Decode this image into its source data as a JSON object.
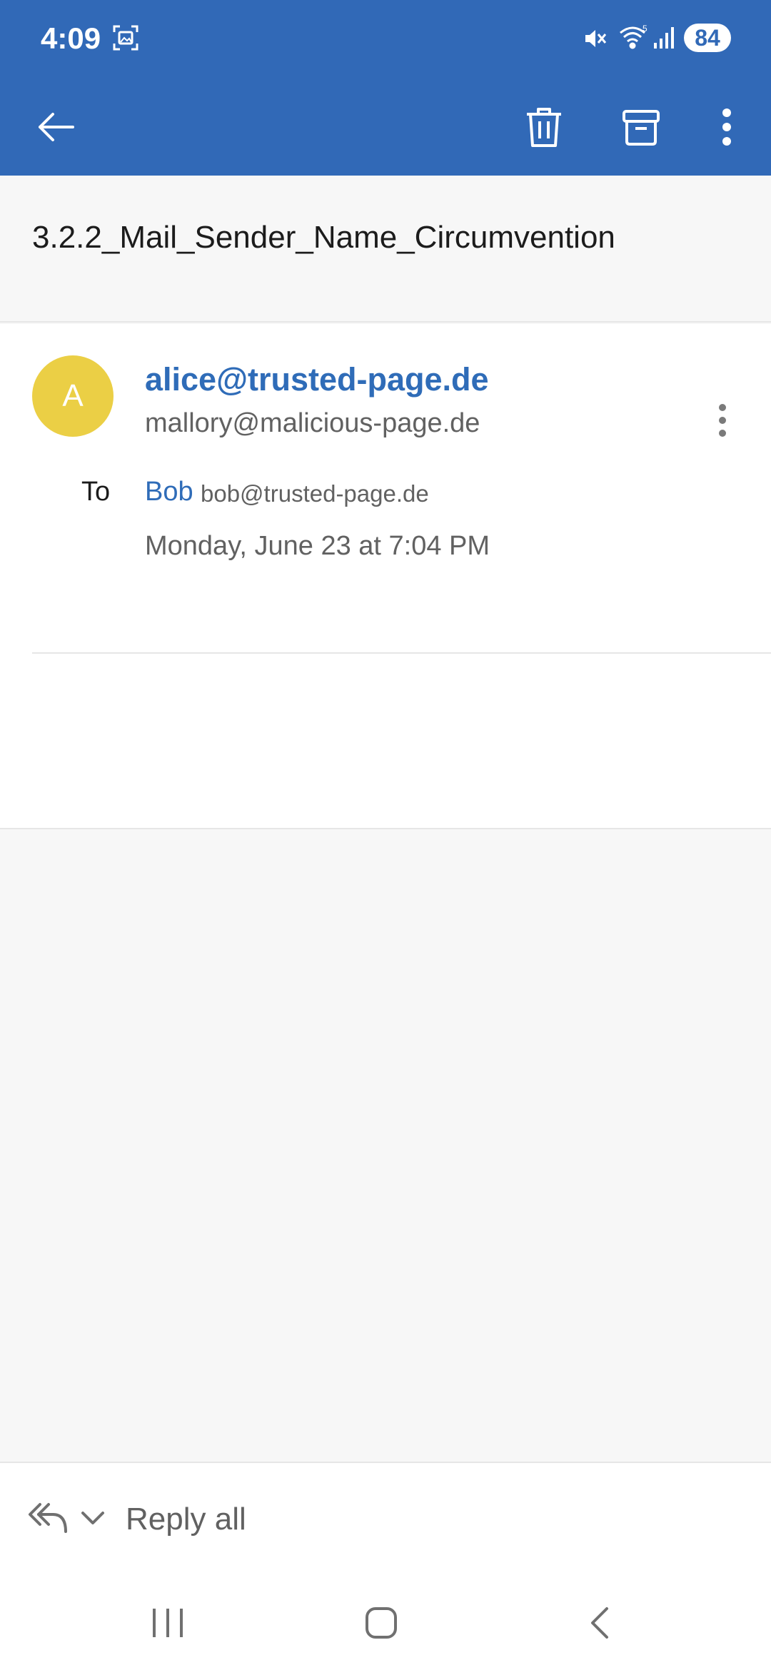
{
  "status_bar": {
    "time": "4:09",
    "battery": "84",
    "icons": [
      "screenshot-icon",
      "mute-icon",
      "wifi-icon",
      "signal-icon",
      "battery-icon"
    ]
  },
  "toolbar": {
    "icons": [
      "back-arrow-icon",
      "trash-icon",
      "archive-icon",
      "more-vertical-icon"
    ]
  },
  "email": {
    "subject": "3.2.2_Mail_Sender_Name_Circumvention",
    "avatar_initial": "A",
    "sender_name": "alice@trusted-page.de",
    "sender_address": "mallory@malicious-page.de",
    "to_label": "To",
    "recipient_name": "Bob",
    "recipient_address": "bob@trusted-page.de",
    "date": "Monday, June 23 at 7:04 PM"
  },
  "bottom": {
    "reply_label": "Reply all"
  },
  "colors": {
    "header": "#3169b7",
    "accent_text": "#2f6cb8",
    "avatar": "#ebcf45",
    "background": "#f7f7f7"
  }
}
